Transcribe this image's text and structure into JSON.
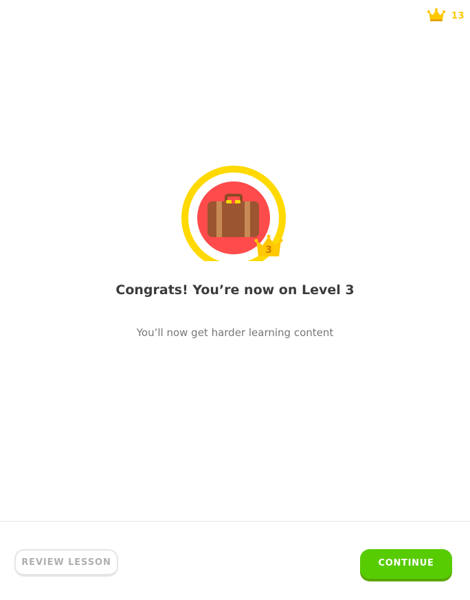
{
  "header": {
    "crown_count": "13",
    "crown_color": "#ffc800"
  },
  "badge": {
    "icon": "suitcase-icon",
    "level": "3",
    "ring_color": "#ffd900",
    "inner_color": "#ff4b4b"
  },
  "message": {
    "title": "Congrats! You’re now on Level 3",
    "subtitle": "You’ll now get harder learning content"
  },
  "footer": {
    "review_label": "REVIEW LESSON",
    "continue_label": "CONTINUE",
    "continue_color": "#58cc02"
  }
}
